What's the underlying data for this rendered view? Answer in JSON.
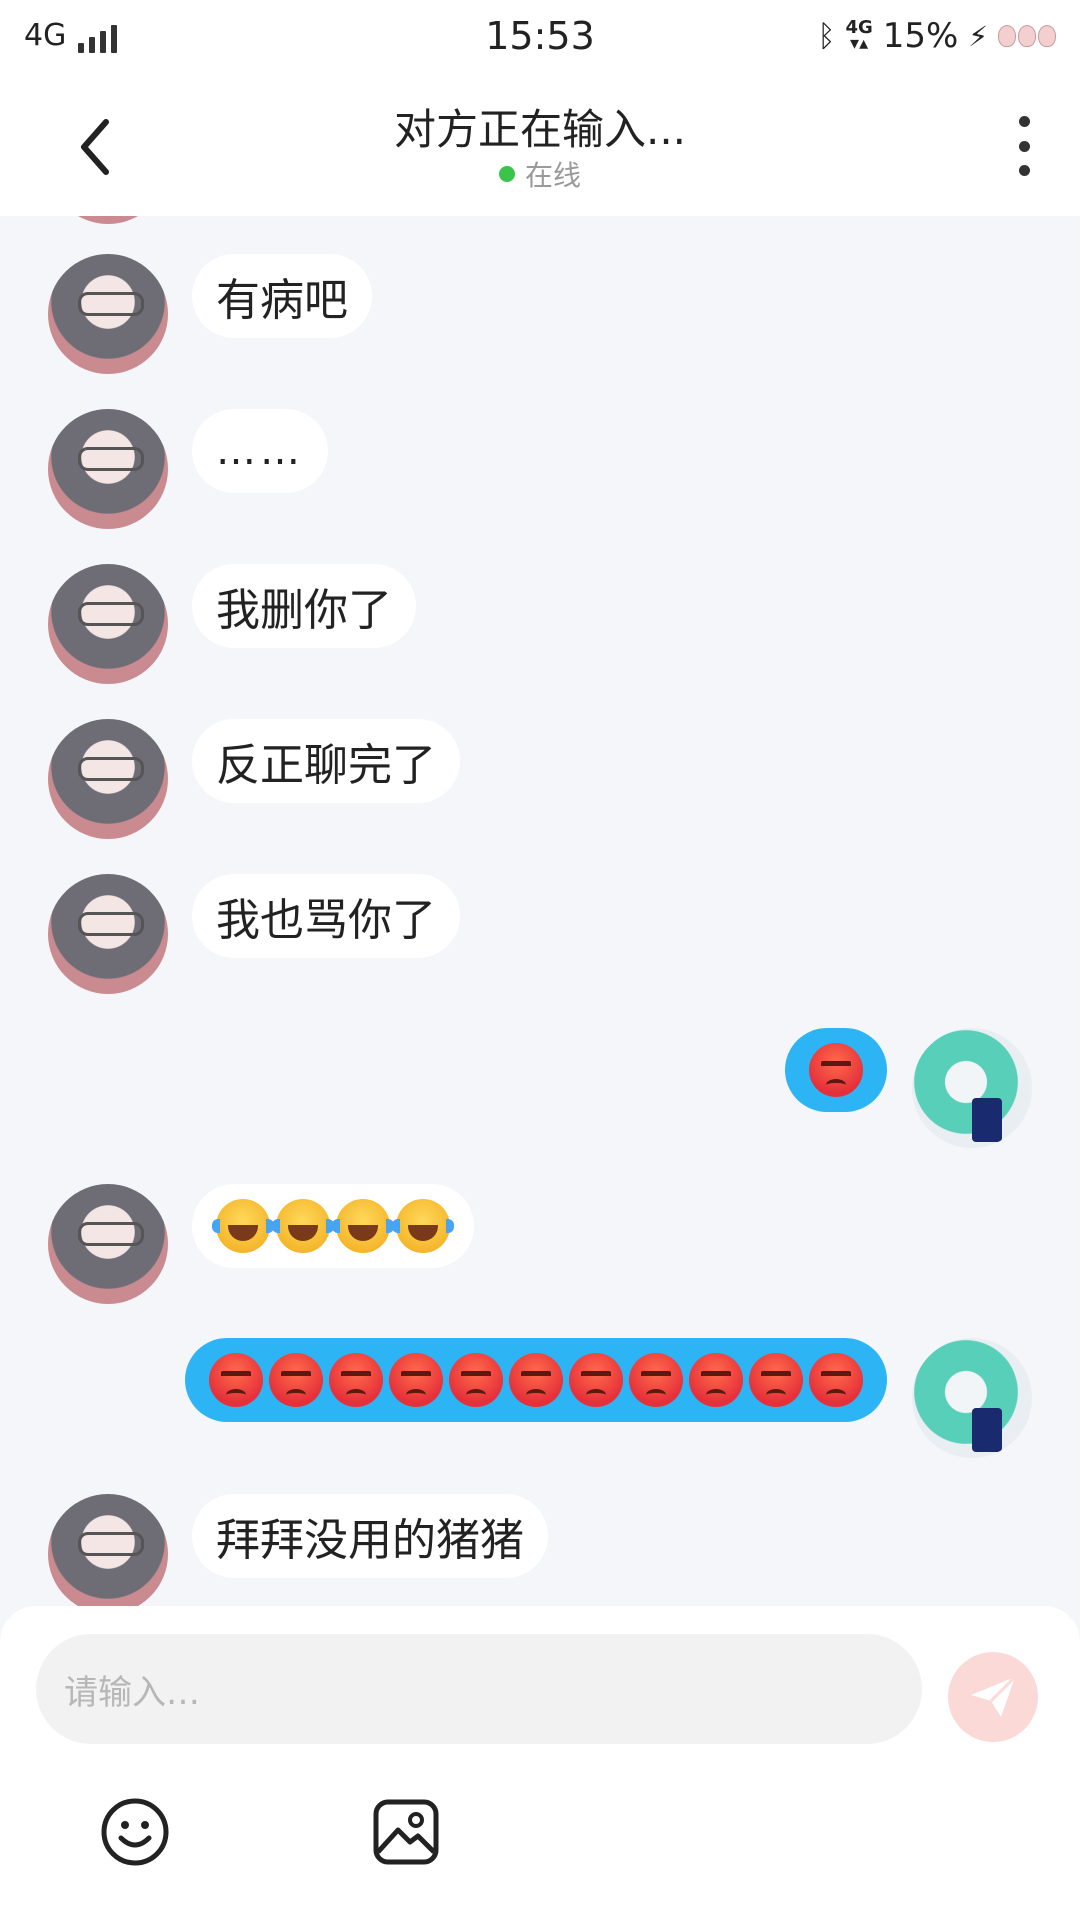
{
  "status_bar": {
    "network": "4G",
    "time": "15:53",
    "net_type_small": "4G",
    "battery": "15%"
  },
  "header": {
    "title": "对方正在输入...",
    "status": "在线",
    "status_color": "#3bc44a"
  },
  "messages": [
    {
      "side": "left",
      "type": "text",
      "text": "有病吧"
    },
    {
      "side": "left",
      "type": "text",
      "text": "……"
    },
    {
      "side": "left",
      "type": "text",
      "text": "我删你了"
    },
    {
      "side": "left",
      "type": "text",
      "text": "反正聊完了"
    },
    {
      "side": "left",
      "type": "text",
      "text": "我也骂你了"
    },
    {
      "side": "right",
      "type": "emoji",
      "emoji": "angry-face",
      "count": 1
    },
    {
      "side": "left",
      "type": "emoji",
      "emoji": "tears-of-joy",
      "count": 4
    },
    {
      "side": "right",
      "type": "emoji",
      "emoji": "angry-face",
      "count": 11
    },
    {
      "side": "left",
      "type": "text",
      "text": "拜拜没用的猪猪"
    }
  ],
  "input": {
    "placeholder": "请输入…",
    "send_icon": "send-icon",
    "send_color": "#fbd9d7"
  },
  "toolbar": {
    "emoji_icon": "smiley-icon",
    "image_icon": "image-icon"
  },
  "colors": {
    "my_bubble": "#2db4f5",
    "their_bubble": "#ffffff",
    "background": "#f4f6f9"
  }
}
